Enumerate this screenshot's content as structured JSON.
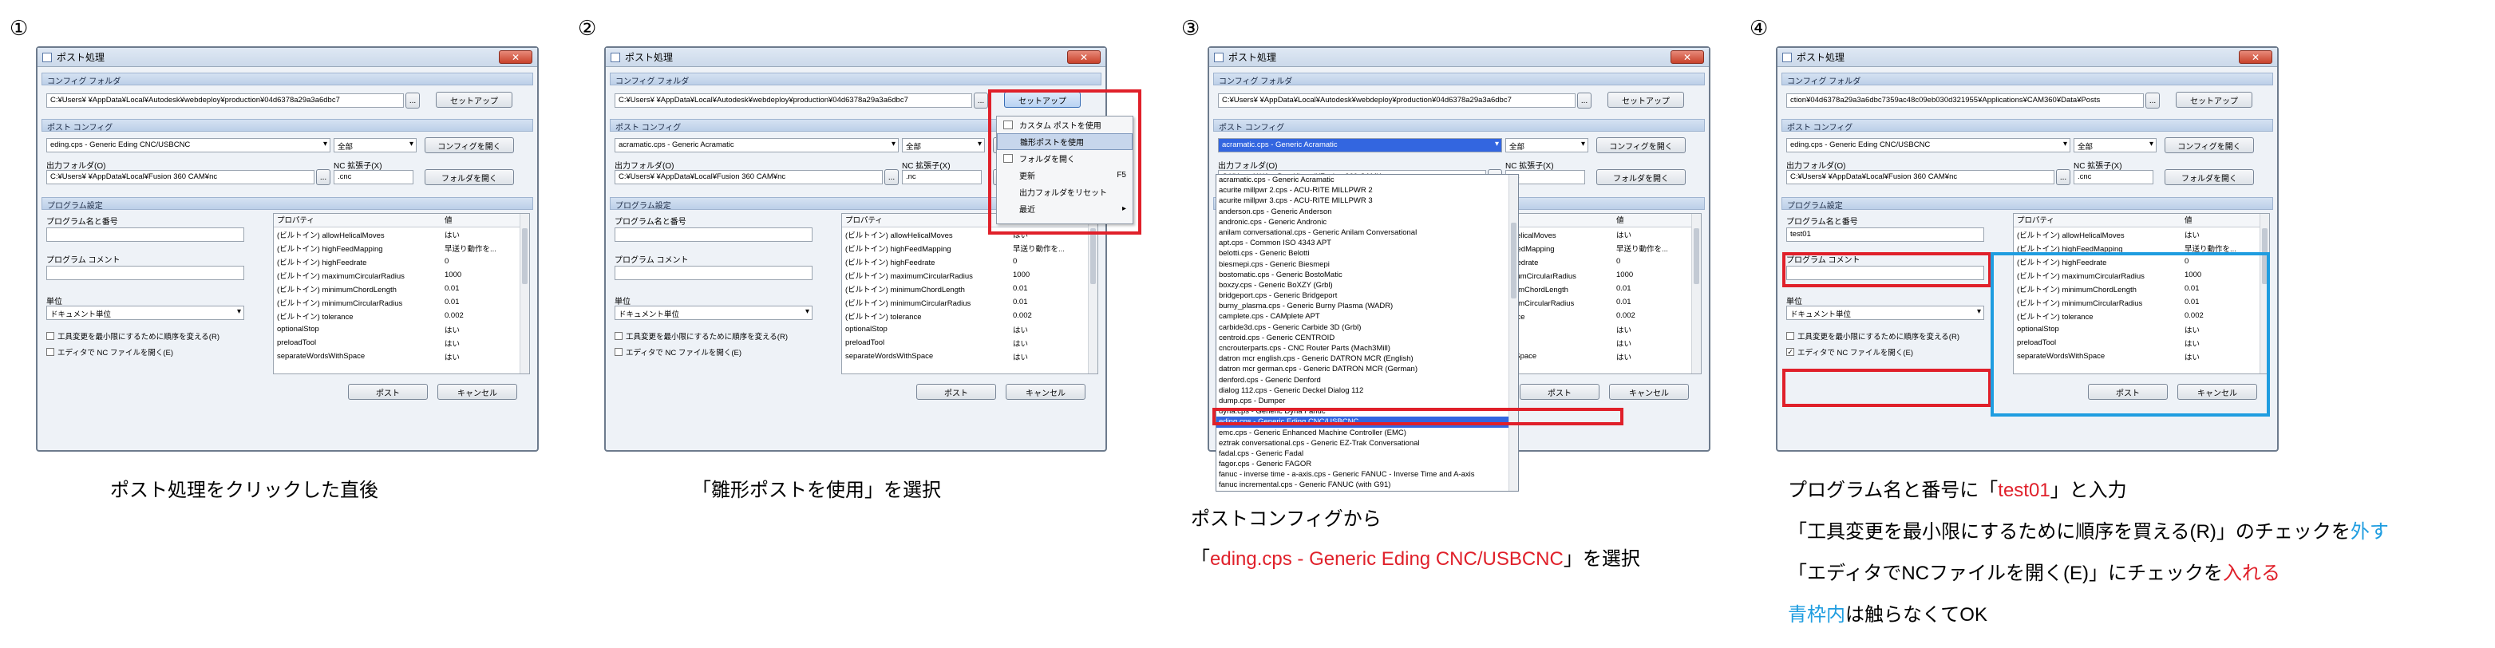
{
  "colors": {
    "accent_red": "#e0202a",
    "accent_blue": "#1f9de0",
    "dialog_bg": "#eef2f7",
    "highlight": "#3366e0"
  },
  "dialog": {
    "title": "ポスト処理",
    "close_icon": "close-icon",
    "config_folder_header": "コンフィグ フォルダ",
    "config_folder_path": "C:¥Users¥      ¥AppData¥Local¥Autodesk¥webdeploy¥production¥04d6378a29a3a6dbc7",
    "browse_label": "...",
    "setup_label": "セットアップ",
    "post_config_header": "ポスト コンフィグ",
    "post_eding": "eding.cps - Generic Eding CNC/USBCNC",
    "post_acramatic": "acramatic.cps - Generic Acramatic",
    "filter_all": "全部",
    "open_config_label": "コンフィグを開く",
    "output_folder_label": "出力フォルダ(O)",
    "output_folder_path": "C:¥Users¥      ¥AppData¥Local¥Fusion 360 CAM¥nc",
    "nc_ext_label": "NC 拡張子(X)",
    "nc_ext_value": ".cnc",
    "nc_ext_value2": ".nc",
    "open_folder_label": "フォルダを開く",
    "program_settings_header": "プログラム設定",
    "program_name_label": "プログラム名と番号",
    "program_comment_label": "プログラム コメント",
    "unit_label": "単位",
    "unit_value": "ドキュメント単位",
    "tool_change_option": "工具変更を最小限にするために順序を変える(R)",
    "open_editor_option": "エディタで NC ファイルを開く(E)",
    "ok_label": "ポスト",
    "cancel_label": "キャンセル",
    "props_col_property": "プロパティ",
    "props_col_value": "値",
    "properties": [
      {
        "name": "(ビルトイン) allowHelicalMoves",
        "value": "はい"
      },
      {
        "name": "(ビルトイン) highFeedMapping",
        "value": "早送り動作を..."
      },
      {
        "name": "(ビルトイン) highFeedrate",
        "value": "0"
      },
      {
        "name": "(ビルトイン) maximumCircularRadius",
        "value": "1000"
      },
      {
        "name": "(ビルトイン) minimumChordLength",
        "value": "0.01"
      },
      {
        "name": "(ビルトイン) minimumCircularRadius",
        "value": "0.01"
      },
      {
        "name": "(ビルトイン) tolerance",
        "value": "0.002"
      },
      {
        "name": "optionalStop",
        "value": "はい"
      },
      {
        "name": "preloadTool",
        "value": "はい"
      },
      {
        "name": "separateWordsWithSpace",
        "value": "はい"
      }
    ]
  },
  "panel1": {
    "number": "①",
    "caption": "ポスト処理をクリックした直後"
  },
  "panel2": {
    "number": "②",
    "caption": "「雛形ポストを使用」を選択",
    "menu": [
      {
        "label": "カスタム ポストを使用",
        "shortcut": ""
      },
      {
        "label": "雛形ポストを使用",
        "shortcut": ""
      },
      {
        "label": "フォルダを開く",
        "shortcut": ""
      },
      {
        "label": "更新",
        "shortcut": "F5"
      },
      {
        "label": "出力フォルダをリセット",
        "shortcut": ""
      },
      {
        "label": "最近",
        "shortcut": "▸"
      }
    ]
  },
  "panel3": {
    "number": "③",
    "caption_line1": "ポストコンフィグから",
    "caption_open": "「",
    "caption_red": "eding.cps - Generic Eding CNC/USBCNC",
    "caption_close": "」を選択",
    "dropdown": [
      "acramatic.cps - Generic Acramatic",
      "acurite millpwr 2.cps - ACU-RITE MILLPWR 2",
      "acurite millpwr 3.cps - ACU-RITE MILLPWR 3",
      "anderson.cps - Generic Anderson",
      "andronic.cps - Generic Andronic",
      "anilam conversational.cps - Generic Anilam Conversational",
      "apt.cps - Common ISO 4343 APT",
      "belotti.cps - Generic Belotti",
      "biesmepi.cps - Generic Biesmepi",
      "bostomatic.cps - Generic BostoMatic",
      "boxzy.cps - Generic BoXZY (Grbl)",
      "bridgeport.cps - Generic Bridgeport",
      "burny_plasma.cps - Generic Burny Plasma (WADR)",
      "camplete.cps - CAMplete APT",
      "carbide3d.cps - Generic Carbide 3D (Grbl)",
      "centroid.cps - Generic CENTROID",
      "cncrouterparts.cps - CNC Router Parts (Mach3Mill)",
      "datron mcr english.cps - Generic DATRON MCR (English)",
      "datron mcr german.cps - Generic DATRON MCR (German)",
      "denford.cps - Generic Denford",
      "dialog 112.cps - Generic Deckel Dialog 112",
      "dump.cps - Dumper",
      "dyna.cps - Generic Dyna Fanuc",
      "eding.cps - Generic Eding CNC/USBCNC",
      "emc.cps - Generic Enhanced Machine Controller (EMC)",
      "eztrak conversational.cps - Generic EZ-Trak Conversational",
      "fadal.cps - Generic Fadal",
      "fagor.cps - Generic FAGOR",
      "fanuc - inverse time - a-axis.cps - Generic FANUC - Inverse Time and A-axis",
      "fanuc incremental.cps - Generic FANUC (with G91)"
    ]
  },
  "panel4": {
    "number": "④",
    "config_folder_path": "ction¥04d6378a29a3a6dbc7359ac48c09eb030d321955¥Applications¥CAM360¥Data¥Posts",
    "program_name_value": "test01",
    "caption1_pre": "プログラム名と番号に「",
    "caption1_red": "test01",
    "caption1_post": "」と入力",
    "caption2_pre": "「工具変更を最小限にするために順序を買える(R)」のチェックを",
    "caption2_blue": "外す",
    "caption3_pre": "「エディタでNCファイルを開く(E)」にチェックを",
    "caption3_red": "入れる",
    "caption4_blue": "青枠内",
    "caption4_post": "は触らなくてOK"
  }
}
